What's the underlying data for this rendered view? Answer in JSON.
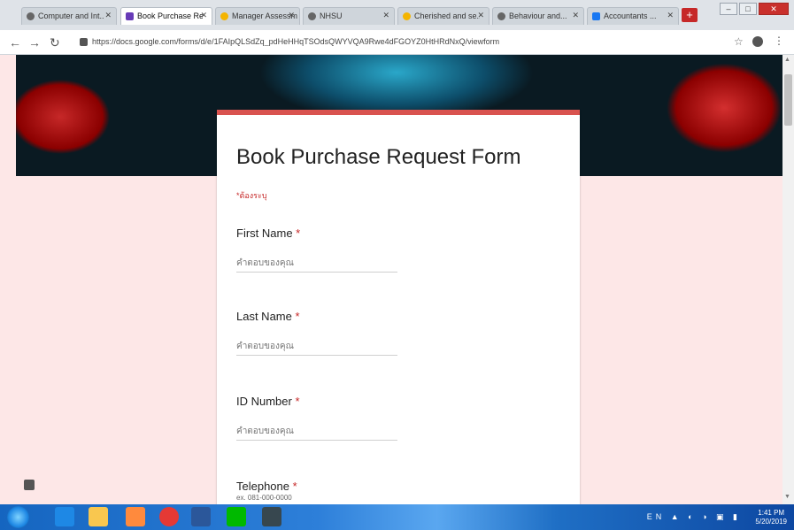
{
  "browser": {
    "tabs": [
      {
        "label": "Computer and Int...",
        "active": false
      },
      {
        "label": "Book Purchase Re...",
        "active": true
      },
      {
        "label": "Manager Assessm...",
        "active": false
      },
      {
        "label": "NHSU",
        "active": false
      },
      {
        "label": "Cherished and se...",
        "active": false
      },
      {
        "label": "Behaviour and...",
        "active": false
      },
      {
        "label": "Accountants ...",
        "active": false
      }
    ],
    "url": "https://docs.google.com/forms/d/e/1FAIpQLSdZq_pdHeHHqTSOdsQWYVQA9Rwe4dFGOYZ0HtHRdNxQ/viewform"
  },
  "form": {
    "title": "Book Purchase Request Form",
    "required_note": "*ต้องระบุ",
    "questions": [
      {
        "label": "First Name",
        "required_mark": " *",
        "placeholder": "คำตอบของคุณ"
      },
      {
        "label": "Last Name",
        "required_mark": " *",
        "placeholder": "คำตอบของคุณ"
      },
      {
        "label": "ID Number",
        "required_mark": " *",
        "placeholder": "คำตอบของคุณ"
      },
      {
        "label": "Telephone",
        "required_mark": " *",
        "sub": "ex. 081-000-0000"
      }
    ]
  },
  "taskbar": {
    "tray": "EN ▲ ◐ ◑ ▣ ▮",
    "time": "1:41 PM",
    "date": "5/20/2019"
  }
}
